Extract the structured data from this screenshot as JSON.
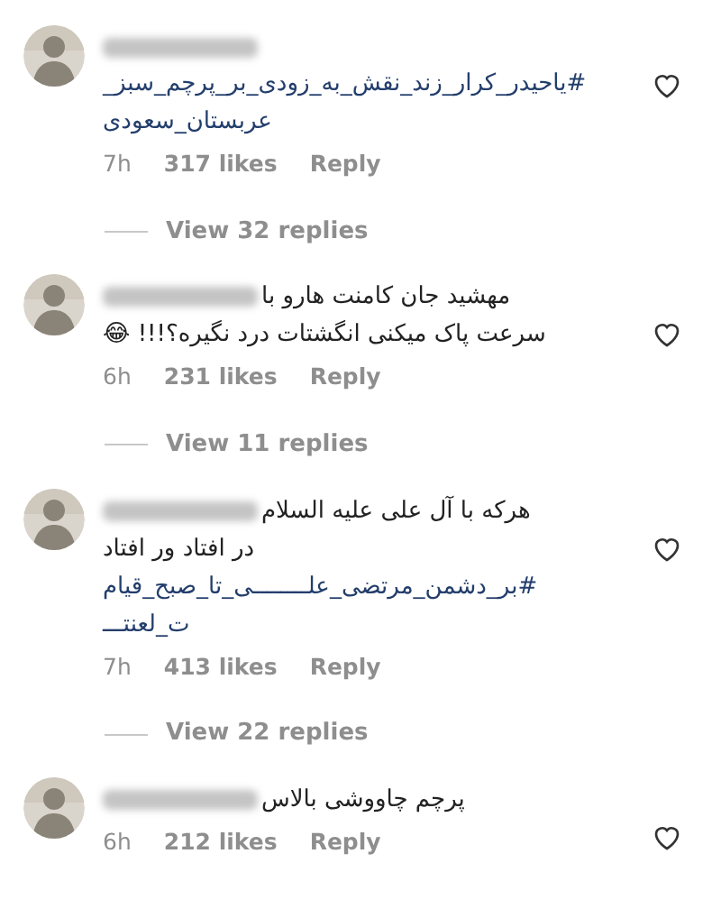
{
  "comments": [
    {
      "kind": "stacked",
      "lines": [
        {
          "kind": "hashtag",
          "text": "#یاحیدر_کرار_زند_نقش_به_زودی_بر_پرچم_سبز_"
        },
        {
          "kind": "hashtag",
          "text": "عربستان_سعودی"
        }
      ],
      "time": "7h",
      "likes": "317 likes",
      "reply": "Reply",
      "liked": false,
      "view_replies": "View 32 replies"
    },
    {
      "kind": "inline",
      "lines": [
        {
          "kind": "text",
          "text": "مهشید جان کامنت هارو با"
        },
        {
          "kind": "text",
          "text": "سرعت پاک میکنی انگشتات درد نگیره؟!!! 😂"
        }
      ],
      "time": "6h",
      "likes": "231 likes",
      "reply": "Reply",
      "liked": false,
      "view_replies": "View 11 replies"
    },
    {
      "kind": "inline",
      "lines": [
        {
          "kind": "text",
          "text": "هرکه با آل علی علیه السلام"
        },
        {
          "kind": "text",
          "text": "در افتاد ور افتاد"
        },
        {
          "kind": "hashtag",
          "text": "#بر_دشمن_مرتضی_علــــــــی_تا_صبح_قیام"
        },
        {
          "kind": "hashtag",
          "text": "ت_لعنتـــ"
        }
      ],
      "time": "7h",
      "likes": "413 likes",
      "reply": "Reply",
      "liked": false,
      "view_replies": "View 22 replies"
    },
    {
      "kind": "inline",
      "lines": [
        {
          "kind": "text",
          "text": "پرچم چاووشی بالاس"
        }
      ],
      "time": "6h",
      "likes": "212 likes",
      "reply": "Reply",
      "liked": false
    }
  ]
}
